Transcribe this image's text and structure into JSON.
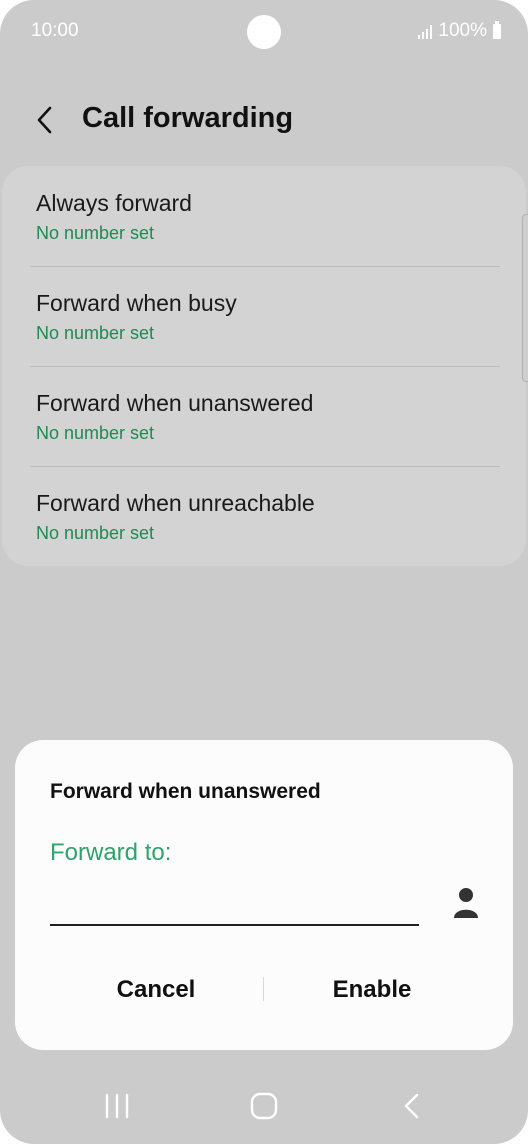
{
  "status_bar": {
    "time": "10:00",
    "battery": "100%"
  },
  "header": {
    "title": "Call forwarding"
  },
  "settings": {
    "items": [
      {
        "title": "Always forward",
        "subtitle": "No number set"
      },
      {
        "title": "Forward when busy",
        "subtitle": "No number set"
      },
      {
        "title": "Forward when unanswered",
        "subtitle": "No number set"
      },
      {
        "title": "Forward when unreachable",
        "subtitle": "No number set"
      }
    ]
  },
  "dialog": {
    "title": "Forward when unanswered",
    "field_label": "Forward to:",
    "input_value": "",
    "cancel_label": "Cancel",
    "enable_label": "Enable"
  },
  "icons": {
    "back": "chevron-left-icon",
    "contact": "person-icon",
    "nav_recents": "recents-icon",
    "nav_home": "home-icon",
    "nav_back": "back-icon"
  },
  "colors": {
    "accent_green": "#2ea36b",
    "subtitle_green": "#1f8a52",
    "scrim_background": "#cbcbcb",
    "dialog_background": "#fcfcfc"
  }
}
